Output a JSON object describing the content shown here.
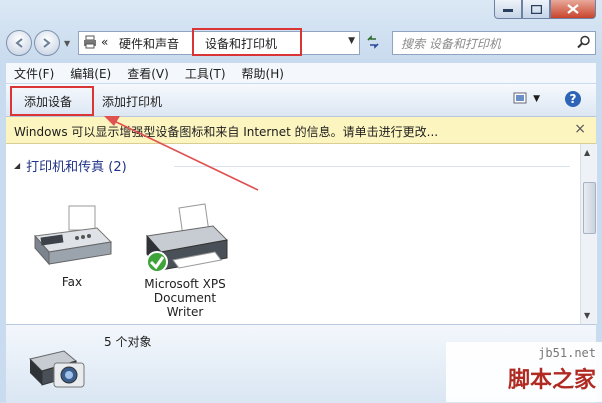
{
  "address": {
    "crumbs_sep": "«",
    "crumb_parent": "硬件和声音",
    "crumb_current": "设备和打印机"
  },
  "search": {
    "placeholder": "搜索 设备和打印机"
  },
  "menu": [
    "文件(F)",
    "编辑(E)",
    "查看(V)",
    "工具(T)",
    "帮助(H)"
  ],
  "toolbar": {
    "add_device": "添加设备",
    "add_printer": "添加打印机"
  },
  "infobar": {
    "text": "Windows 可以显示增强型设备图标和来自 Internet 的信息。请单击进行更改...",
    "close": "×"
  },
  "group": {
    "title": "打印机和传真 (2)"
  },
  "devices": [
    {
      "label": "Fax"
    },
    {
      "label_line1": "Microsoft XPS",
      "label_line2": "Document",
      "label_line3": "Writer"
    }
  ],
  "details": {
    "count": "5 个对象"
  },
  "watermark": {
    "site": "jb51.net",
    "name": "脚本之家"
  },
  "colors": {
    "highlight": "#d93535",
    "link_blue": "#1e3287",
    "info_bg": "#fcf5c0"
  },
  "icons": [
    "back-arrow",
    "forward-arrow",
    "refresh",
    "search",
    "help",
    "view-options",
    "printer",
    "fax",
    "check"
  ]
}
